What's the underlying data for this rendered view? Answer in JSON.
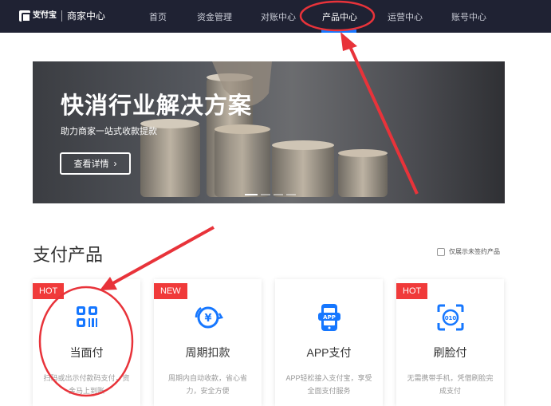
{
  "nav": {
    "logo_text": "支付宝",
    "logo_sub": "ALIPAY",
    "portal_title": "商家中心",
    "items": [
      {
        "label": "首页"
      },
      {
        "label": "资金管理"
      },
      {
        "label": "对账中心"
      },
      {
        "label": "产品中心",
        "active": true
      },
      {
        "label": "运营中心"
      },
      {
        "label": "账号中心"
      }
    ]
  },
  "banner": {
    "title": "快消行业解决方案",
    "subtitle": "助力商家一站式收款提款",
    "button_label": "查看详情",
    "button_icon": "chevron-right-icon",
    "slides_count": 4,
    "active_slide": 1
  },
  "section": {
    "title": "支付产品",
    "filter_label": "仅展示未签约产品",
    "filter_checked": false
  },
  "products": [
    {
      "badge": "HOT",
      "name": "当面付",
      "desc": "扫码或出示付款码支付，资金马上到账",
      "icon": "qr-code-icon"
    },
    {
      "badge": "NEW",
      "name": "周期扣款",
      "desc": "周期内自动收款，省心省力，安全方便",
      "icon": "yen-cycle-icon"
    },
    {
      "badge": "",
      "name": "APP支付",
      "desc": "APP轻松接入支付宝，享受全面支付服务",
      "icon": "app-phone-icon"
    },
    {
      "badge": "HOT",
      "name": "刷脸付",
      "desc": "无需携带手机，凭借刷脸完成支付",
      "icon": "face-scan-icon"
    }
  ],
  "colors": {
    "nav_bg": "#1f2233",
    "accent": "#1677ff",
    "hot_badge": "#f03a3a",
    "new_badge": "#f03a3a",
    "annotation": "#e8333a",
    "icon_blue": "#1677ff"
  }
}
